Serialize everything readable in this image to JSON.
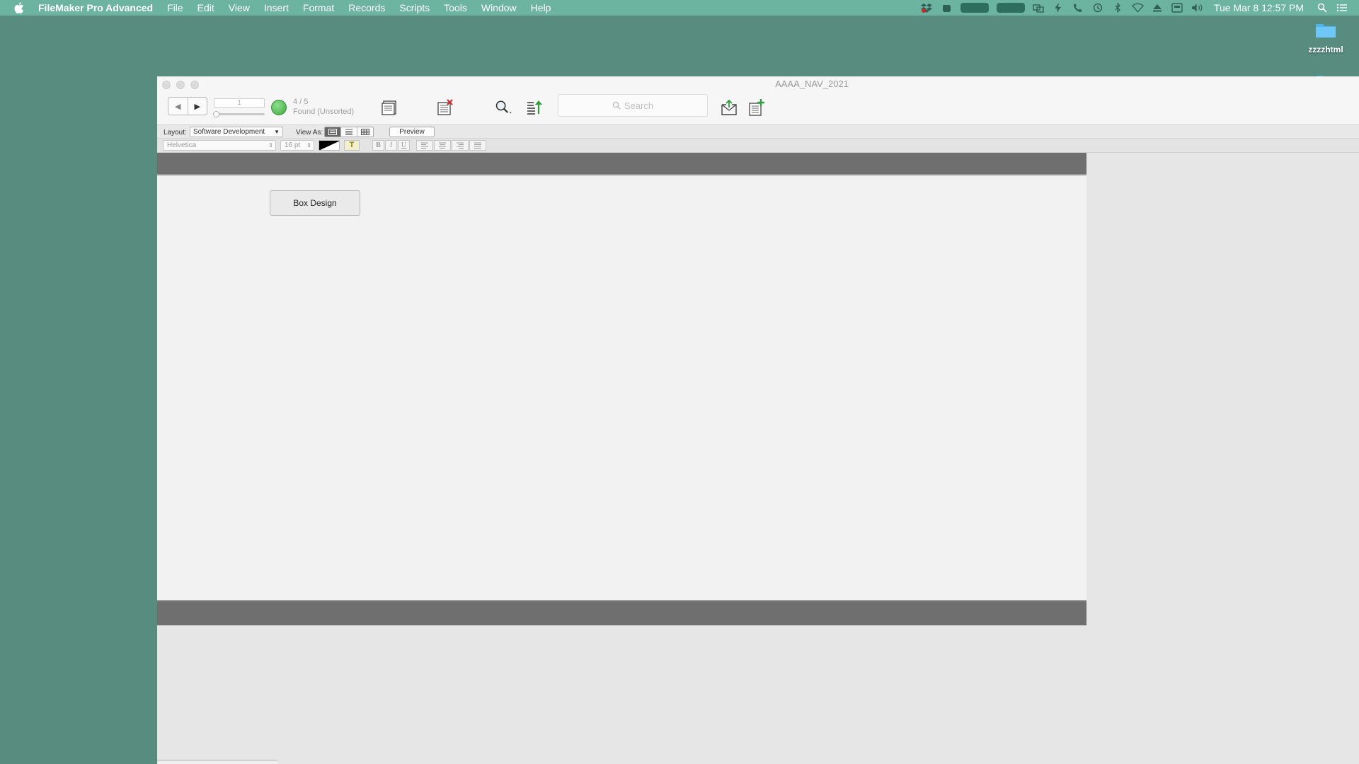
{
  "menubar": {
    "app_name": "FileMaker Pro Advanced",
    "items": [
      "File",
      "Edit",
      "View",
      "Insert",
      "Format",
      "Records",
      "Scripts",
      "Tools",
      "Window",
      "Help"
    ],
    "clock": "Tue Mar 8  12:57 PM",
    "status_icons": [
      "dropbox-icon",
      "evernote-icon",
      "battery-indicator",
      "battery-indicator",
      "screens-icon",
      "lightning-icon",
      "phone-icon",
      "time-machine-icon",
      "bluetooth-icon",
      "wifi-icon",
      "eject-icon",
      "input-menu-icon",
      "volume-icon",
      "spotlight-icon",
      "notification-center-icon"
    ]
  },
  "desktop": {
    "folder_label": "zzzzhtml"
  },
  "window": {
    "title": "AAAA_NAV_2021",
    "record_field_value": "1",
    "found_count": "4 / 5",
    "found_status": "Found (Unsorted)",
    "search_placeholder": "Search"
  },
  "layout_bar": {
    "layout_label": "Layout:",
    "layout_value": "Software Development",
    "view_as_label": "View As:",
    "preview_label": "Preview"
  },
  "format_bar": {
    "font_value": "Helvetica",
    "size_value": "16 pt",
    "bold_label": "B",
    "italic_label": "I",
    "underline_label": "U",
    "highlight_label": "T"
  },
  "content": {
    "button_label": "Box Design"
  },
  "colors": {
    "desktop": "#578c7f",
    "menubar": "#6cb3a0",
    "band": "#6f6f6f"
  }
}
